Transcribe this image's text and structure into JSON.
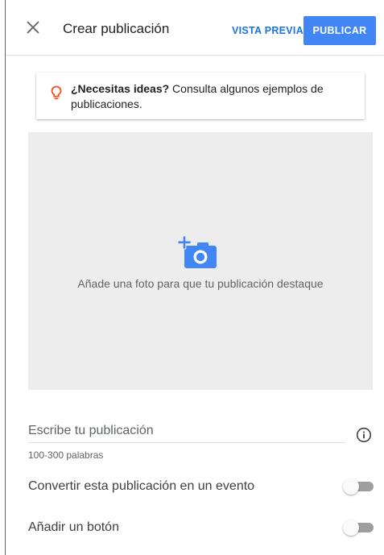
{
  "header": {
    "close_icon": "close-icon",
    "title": "Crear publicación",
    "preview_label": "VISTA PREVIA",
    "publish_label": "PUBLICAR"
  },
  "tip": {
    "icon": "lightbulb-icon",
    "bold_text": "¿Necesitas ideas?",
    "text": " Consulta algunos ejemplos de publicaciones."
  },
  "photo": {
    "icon": "add-photo-icon",
    "label": "Añade una foto para que tu publicación destaque"
  },
  "post": {
    "placeholder": "Escribe tu publicación",
    "hint": "100-300 palabras",
    "info_icon": "info-icon"
  },
  "toggles": {
    "event_label": "Convertir esta publicación en un evento",
    "event_on": false,
    "button_label": "Añadir un botón",
    "button_on": false
  },
  "colors": {
    "accent": "#4285f4",
    "link": "#1a73e8",
    "tip_icon": "#f4511e",
    "photo_bg": "#ededed"
  }
}
